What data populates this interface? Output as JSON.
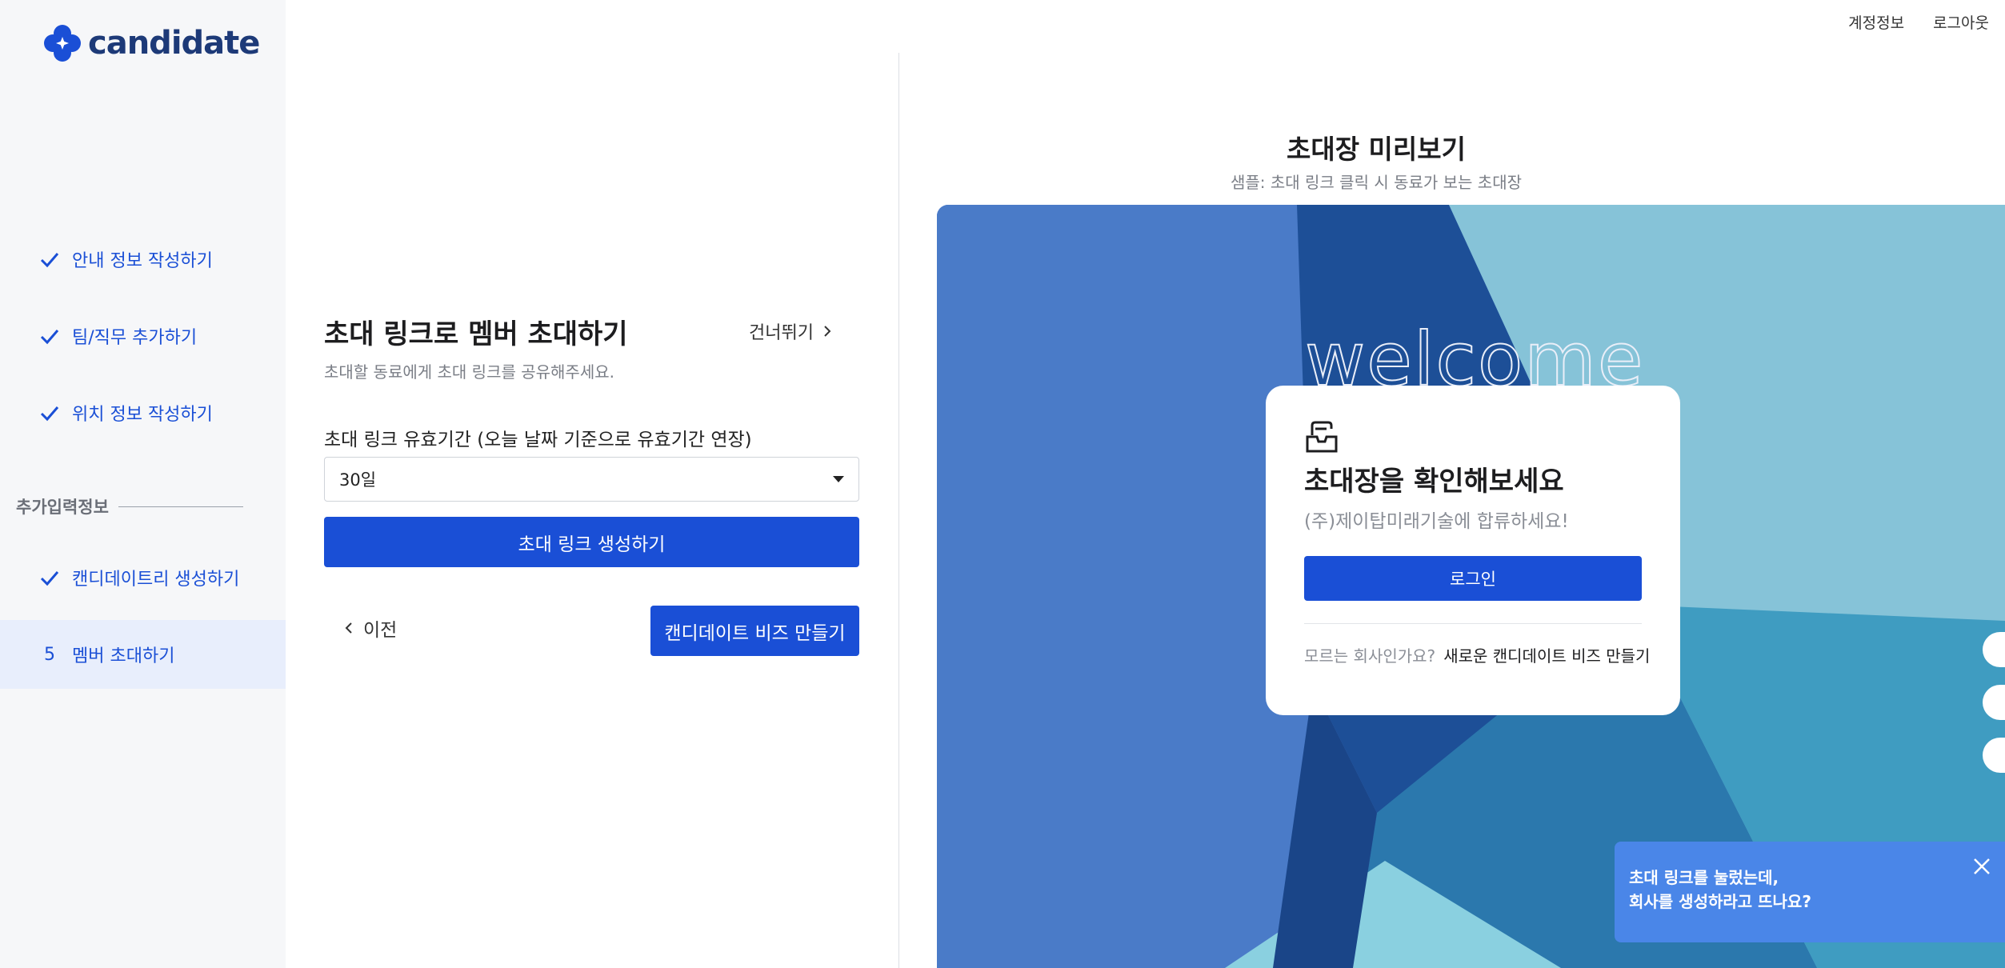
{
  "brand": {
    "name": "candidate",
    "logo_icon": "clover-icon",
    "color": "#1d3a78"
  },
  "toplinks": {
    "account": "계정정보",
    "logout": "로그아웃"
  },
  "sidebar": {
    "steps": [
      {
        "label": "안내 정보 작성하기",
        "icon": "check-icon",
        "done": true
      },
      {
        "label": "팀/직무 추가하기",
        "icon": "check-icon",
        "done": true
      },
      {
        "label": "위치 정보 작성하기",
        "icon": "check-icon",
        "done": true
      }
    ],
    "section_label": "추가입력정보",
    "extra_steps": [
      {
        "label": "캔디데이트리 생성하기",
        "icon": "check-icon",
        "done": true
      },
      {
        "label": "멤버 초대하기",
        "number": "5",
        "active": true
      }
    ]
  },
  "form": {
    "title": "초대 링크로 멤버 초대하기",
    "skip_label": "건너뛰기",
    "subtitle": "초대할 동료에게 초대 링크를 공유해주세요.",
    "field_label": "초대 링크 유효기간 (오늘 날짜 기준으로 유효기간 연장)",
    "select_value": "30일",
    "generate_button": "초대 링크 생성하기",
    "prev_button": "이전",
    "create_button": "캔디데이트 비즈 만들기"
  },
  "preview": {
    "title": "초대장 미리보기",
    "subtitle": "샘플: 초대 링크 클릭 시 동료가 보는 초대장",
    "welcome_text": "welcome",
    "card": {
      "icon": "inbox-tray-icon",
      "title": "초대장을 확인해보세요",
      "subtitle": "(주)제이탑미래기술에 합류하세요!",
      "login_button": "로그인",
      "footer_muted": "모르는 회사인가요?",
      "footer_link": "새로운 캔디데이트 비즈 만들기"
    }
  },
  "help": {
    "line1": "초대 링크를 눌렀는데,",
    "line2": "회사를 생성하라고 뜨나요?"
  },
  "colors": {
    "primary": "#1a4fd6",
    "help_bg": "#4a86e8",
    "sidebar_bg": "#f6f7f9",
    "active_bg": "#e8eefc"
  }
}
